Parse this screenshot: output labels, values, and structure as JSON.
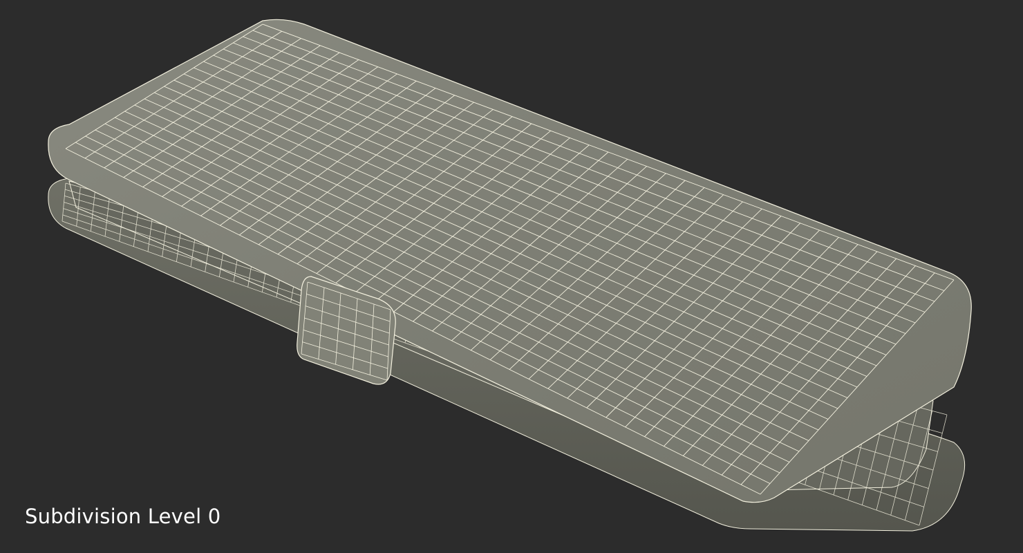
{
  "render": {
    "caption": "Subdivision Level 0",
    "background_color": "#2c2c2c",
    "mesh_color": "#7c7d72",
    "wire_color": "#f4f1df"
  }
}
